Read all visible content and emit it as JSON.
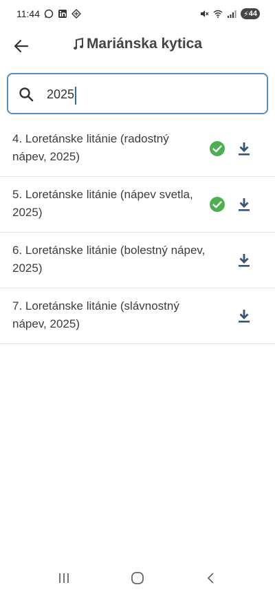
{
  "status_bar": {
    "time": "11:44",
    "left_icons": [
      "whatsapp-icon",
      "linkedin-icon",
      "app-icon"
    ],
    "right_icons": [
      "mute-icon",
      "wifi-icon",
      "signal-icon"
    ],
    "battery": "44"
  },
  "header": {
    "title": "Mariánska kytica",
    "title_icon": "music-note-icon"
  },
  "search": {
    "value": "2025"
  },
  "results": [
    {
      "title": "4. Loretánske litánie (radostný nápev, 2025)",
      "downloaded": true
    },
    {
      "title": "5. Loretánske litánie (nápev svetla, 2025)",
      "downloaded": true
    },
    {
      "title": "6. Loretánske litánie (bolestný nápev, 2025)",
      "downloaded": false
    },
    {
      "title": "7. Loretánske litánie (slávnostný nápev, 2025)",
      "downloaded": false
    }
  ],
  "colors": {
    "accent": "#4f8fbf",
    "check": "#4caf50",
    "download": "#34547a"
  },
  "nav": [
    "recent-apps-icon",
    "home-icon",
    "back-nav-icon"
  ]
}
